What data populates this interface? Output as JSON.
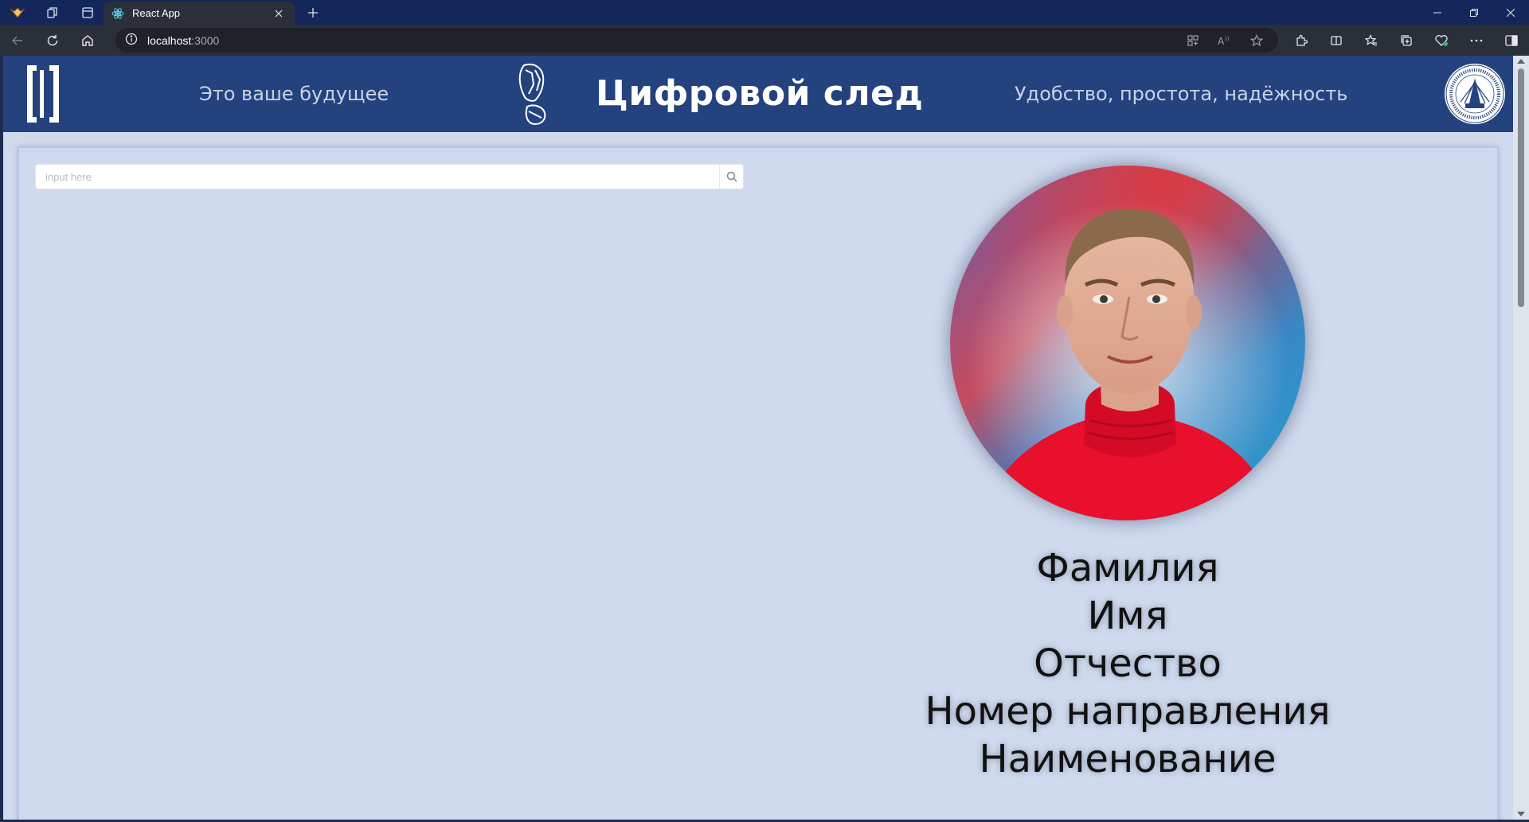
{
  "browser": {
    "tab_title": "React App",
    "url_host": "localhost",
    "url_port": ":3000",
    "icons": [
      "profile-icon",
      "workspaces-icon",
      "vertical-tabs-icon",
      "react-icon",
      "close-icon",
      "plus-icon",
      "minimize-icon",
      "restore-icon",
      "window-close-icon",
      "back-icon",
      "refresh-icon",
      "home-icon",
      "info-icon",
      "app-available-icon",
      "read-aloud-icon",
      "favorite-star-icon",
      "extensions-icon",
      "split-screen-icon",
      "favorites-icon",
      "collections-icon",
      "browser-essentials-icon",
      "more-icon",
      "sidebar-icon"
    ]
  },
  "header": {
    "tagline_left": "Это ваше будущее",
    "title": "Цифровой след",
    "tagline_right": "Удобство, простота, надёжность",
    "background": "#23427e"
  },
  "search": {
    "placeholder": "input here"
  },
  "profile": {
    "last_name": "Фамилия",
    "first_name": "Имя",
    "patronymic": "Отчество",
    "direction_number": "Номер направления",
    "direction_name": "Наименование"
  },
  "colors": {
    "page_background": "#cfdaee",
    "header_background": "#23427e"
  }
}
